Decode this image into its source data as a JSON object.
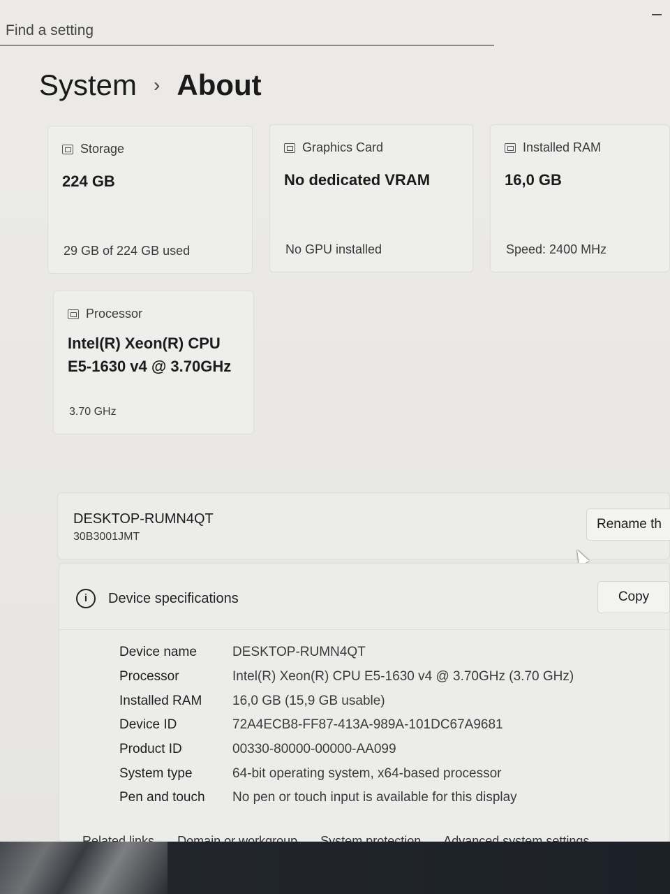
{
  "search": {
    "placeholder": "Find a setting"
  },
  "breadcrumb": {
    "parent": "System",
    "separator": "›",
    "current": "About"
  },
  "cards": {
    "storage": {
      "label": "Storage",
      "value": "224 GB",
      "detail": "29 GB of 224 GB used",
      "icon": "storage-icon"
    },
    "graphics": {
      "label": "Graphics Card",
      "value": "No dedicated VRAM",
      "detail": "No GPU installed",
      "icon": "graphics-card-icon"
    },
    "ram": {
      "label": "Installed RAM",
      "value": "16,0 GB",
      "detail": "Speed: 2400 MHz",
      "icon": "ram-icon"
    },
    "processor": {
      "label": "Processor",
      "value_line1": "Intel(R) Xeon(R) CPU",
      "value_line2": "E5-1630 v4 @ 3.70GHz",
      "detail": "3.70 GHz",
      "icon": "processor-icon"
    }
  },
  "device": {
    "name": "DESKTOP-RUMN4QT",
    "model": "30B3001JMT",
    "rename_label": "Rename th"
  },
  "specs": {
    "title": "Device specifications",
    "copy_label": "Copy",
    "rows": [
      {
        "key": "Device name",
        "value": "DESKTOP-RUMN4QT"
      },
      {
        "key": "Processor",
        "value": "Intel(R) Xeon(R) CPU E5-1630 v4 @ 3.70GHz (3.70 GHz)"
      },
      {
        "key": "Installed RAM",
        "value": "16,0 GB (15,9 GB usable)"
      },
      {
        "key": "Device ID",
        "value": "72A4ECB8-FF87-413A-989A-101DC67A9681"
      },
      {
        "key": "Product ID",
        "value": "00330-80000-00000-AA099"
      },
      {
        "key": "System type",
        "value": "64-bit operating system, x64-based processor"
      },
      {
        "key": "Pen and touch",
        "value": "No pen or touch input is available for this display"
      }
    ]
  },
  "related": {
    "label": "Related links",
    "links": [
      "Domain or workgroup",
      "System protection",
      "Advanced system settings"
    ]
  }
}
